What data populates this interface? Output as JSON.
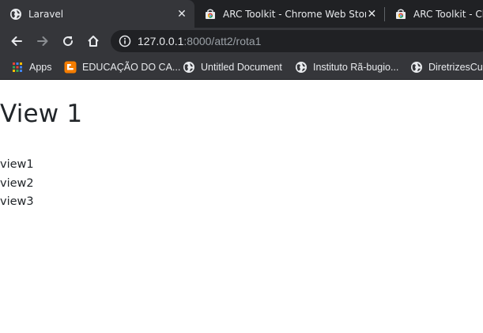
{
  "tabs": [
    {
      "title": "Laravel",
      "active": true
    },
    {
      "title": "ARC Toolkit - Chrome Web Store",
      "active": false
    },
    {
      "title": "ARC Toolkit - Chrome",
      "active": false
    }
  ],
  "toolbar": {
    "url_host": "127.0.0.1",
    "url_rest": ":8000/att2/rota1"
  },
  "bookmarks": [
    {
      "label": "Apps",
      "icon": "apps-grid-icon"
    },
    {
      "label": "EDUCAÇÃO DO CA...",
      "icon": "blogger-icon"
    },
    {
      "label": "Untitled Document",
      "icon": "globe-icon"
    },
    {
      "label": "Instituto Rã-bugio...",
      "icon": "globe-icon"
    },
    {
      "label": "DiretrizesCur",
      "icon": "globe-icon"
    }
  ],
  "page": {
    "heading": "View 1",
    "links": [
      "view1",
      "view2",
      "view3"
    ]
  },
  "colors": {
    "tabstrip": "#202124",
    "toolbar": "#35363a",
    "text_light": "#e8eaed",
    "page_text": "#212529"
  }
}
